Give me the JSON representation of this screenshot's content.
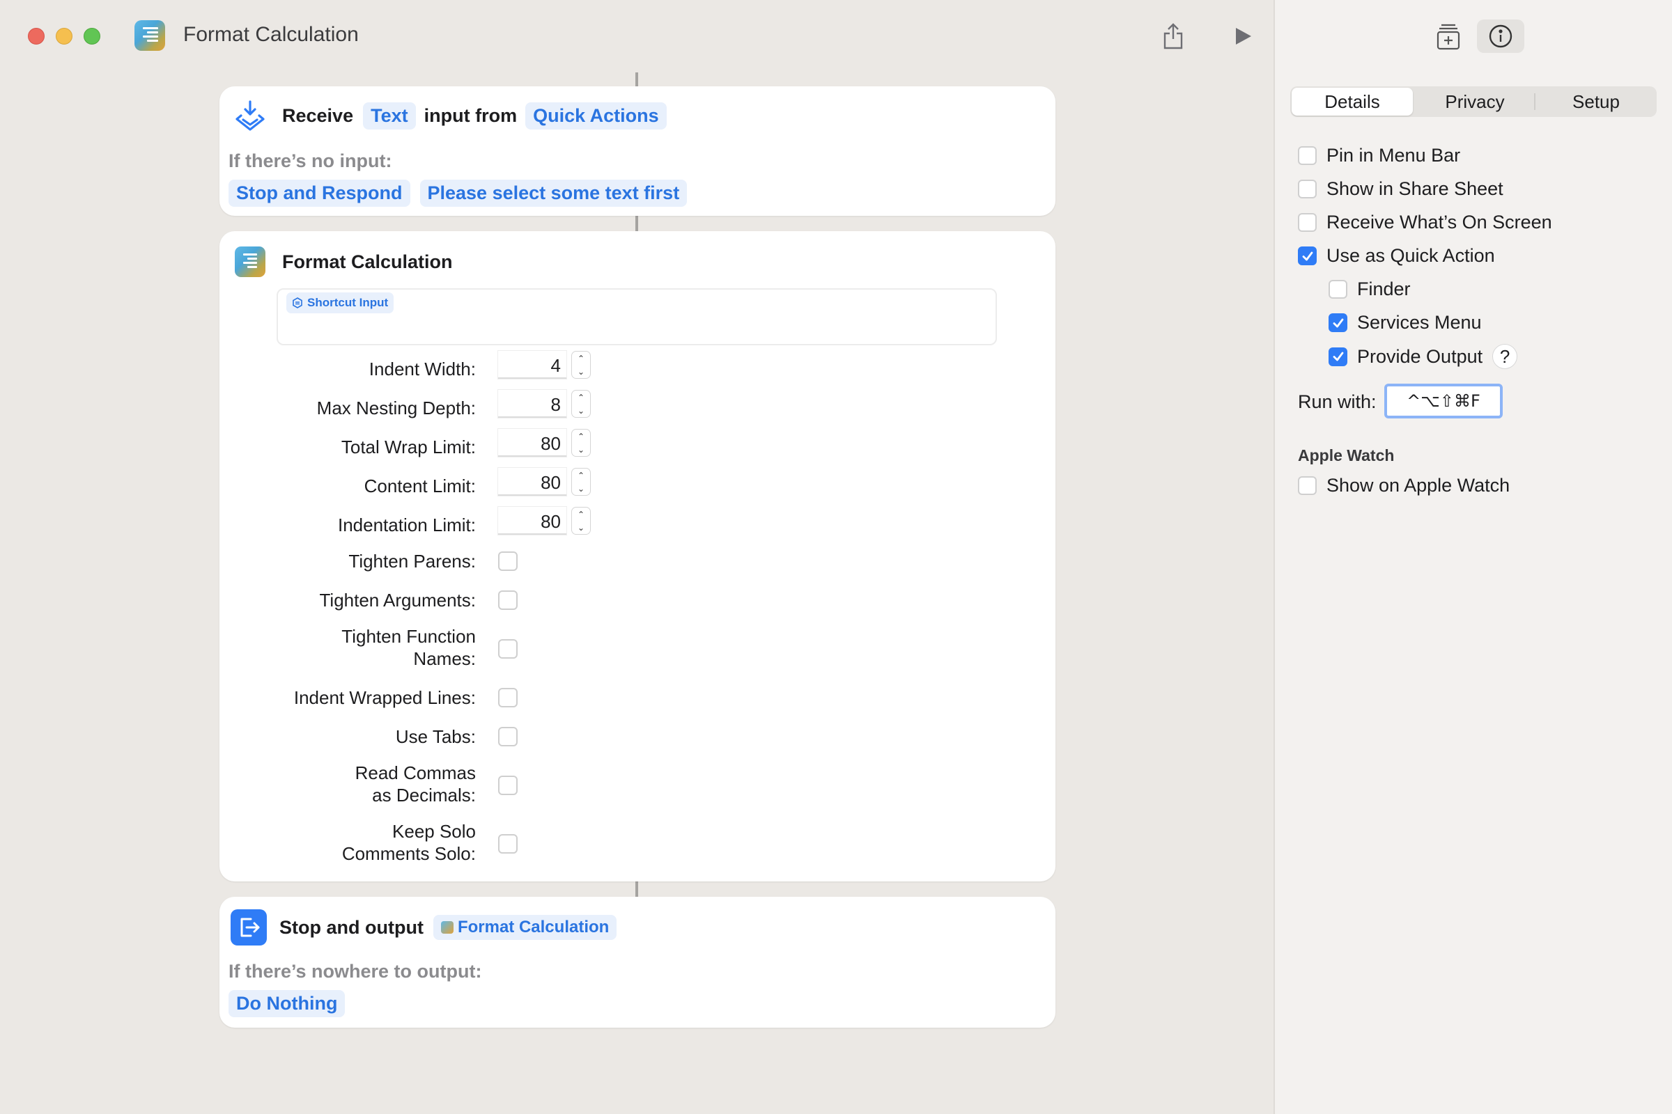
{
  "window": {
    "title": "Format Calculation"
  },
  "receive_card": {
    "receive": "Receive",
    "type_token": "Text",
    "input_from": "input from",
    "source_token": "Quick Actions",
    "no_input_label": "If there’s no input:",
    "stop_token": "Stop and Respond",
    "message_token": "Please select some text first"
  },
  "format_card": {
    "title": "Format Calculation",
    "input_variable": "Shortcut Input",
    "number_params": [
      {
        "label": "Indent Width:",
        "value": "4"
      },
      {
        "label": "Max Nesting Depth:",
        "value": "8"
      },
      {
        "label": "Total Wrap Limit:",
        "value": "80"
      },
      {
        "label": "Content Limit:",
        "value": "80"
      },
      {
        "label": "Indentation Limit:",
        "value": "80"
      }
    ],
    "bool_params": [
      {
        "label": "Tighten Parens:",
        "checked": false
      },
      {
        "label": "Tighten Arguments:",
        "checked": false
      },
      {
        "label1": "Tighten Function",
        "label2": "Names:",
        "checked": false
      },
      {
        "label": "Indent Wrapped Lines:",
        "checked": false
      },
      {
        "label": "Use Tabs:",
        "checked": false
      },
      {
        "label1": "Read Commas",
        "label2": "as Decimals:",
        "checked": false
      },
      {
        "label1": "Keep Solo",
        "label2": "Comments Solo:",
        "checked": false
      }
    ]
  },
  "output_card": {
    "stop_output": "Stop and output",
    "output_token": "Format Calculation",
    "nowhere_label": "If there’s nowhere to output:",
    "do_nothing_token": "Do Nothing"
  },
  "sidebar": {
    "tabs": [
      "Details",
      "Privacy",
      "Setup"
    ],
    "active_tab": "Details",
    "options": [
      {
        "label": "Pin in Menu Bar",
        "checked": false
      },
      {
        "label": "Show in Share Sheet",
        "checked": false
      },
      {
        "label": "Receive What’s On Screen",
        "checked": false
      },
      {
        "label": "Use as Quick Action",
        "checked": true
      }
    ],
    "quick_action_options": [
      {
        "label": "Finder",
        "checked": false
      },
      {
        "label": "Services Menu",
        "checked": true
      },
      {
        "label": "Provide Output",
        "checked": true
      }
    ],
    "help": "?",
    "run_with_label": "Run with:",
    "shortcut": "^⌥⇧⌘F",
    "apple_watch_heading": "Apple Watch",
    "watch_option": {
      "label": "Show on Apple Watch",
      "checked": false
    }
  },
  "colors": {
    "accent": "#2f7cf6",
    "token_bg": "#e8f0fc",
    "token_text": "#2a74e0",
    "background": "#ebe8e4"
  }
}
